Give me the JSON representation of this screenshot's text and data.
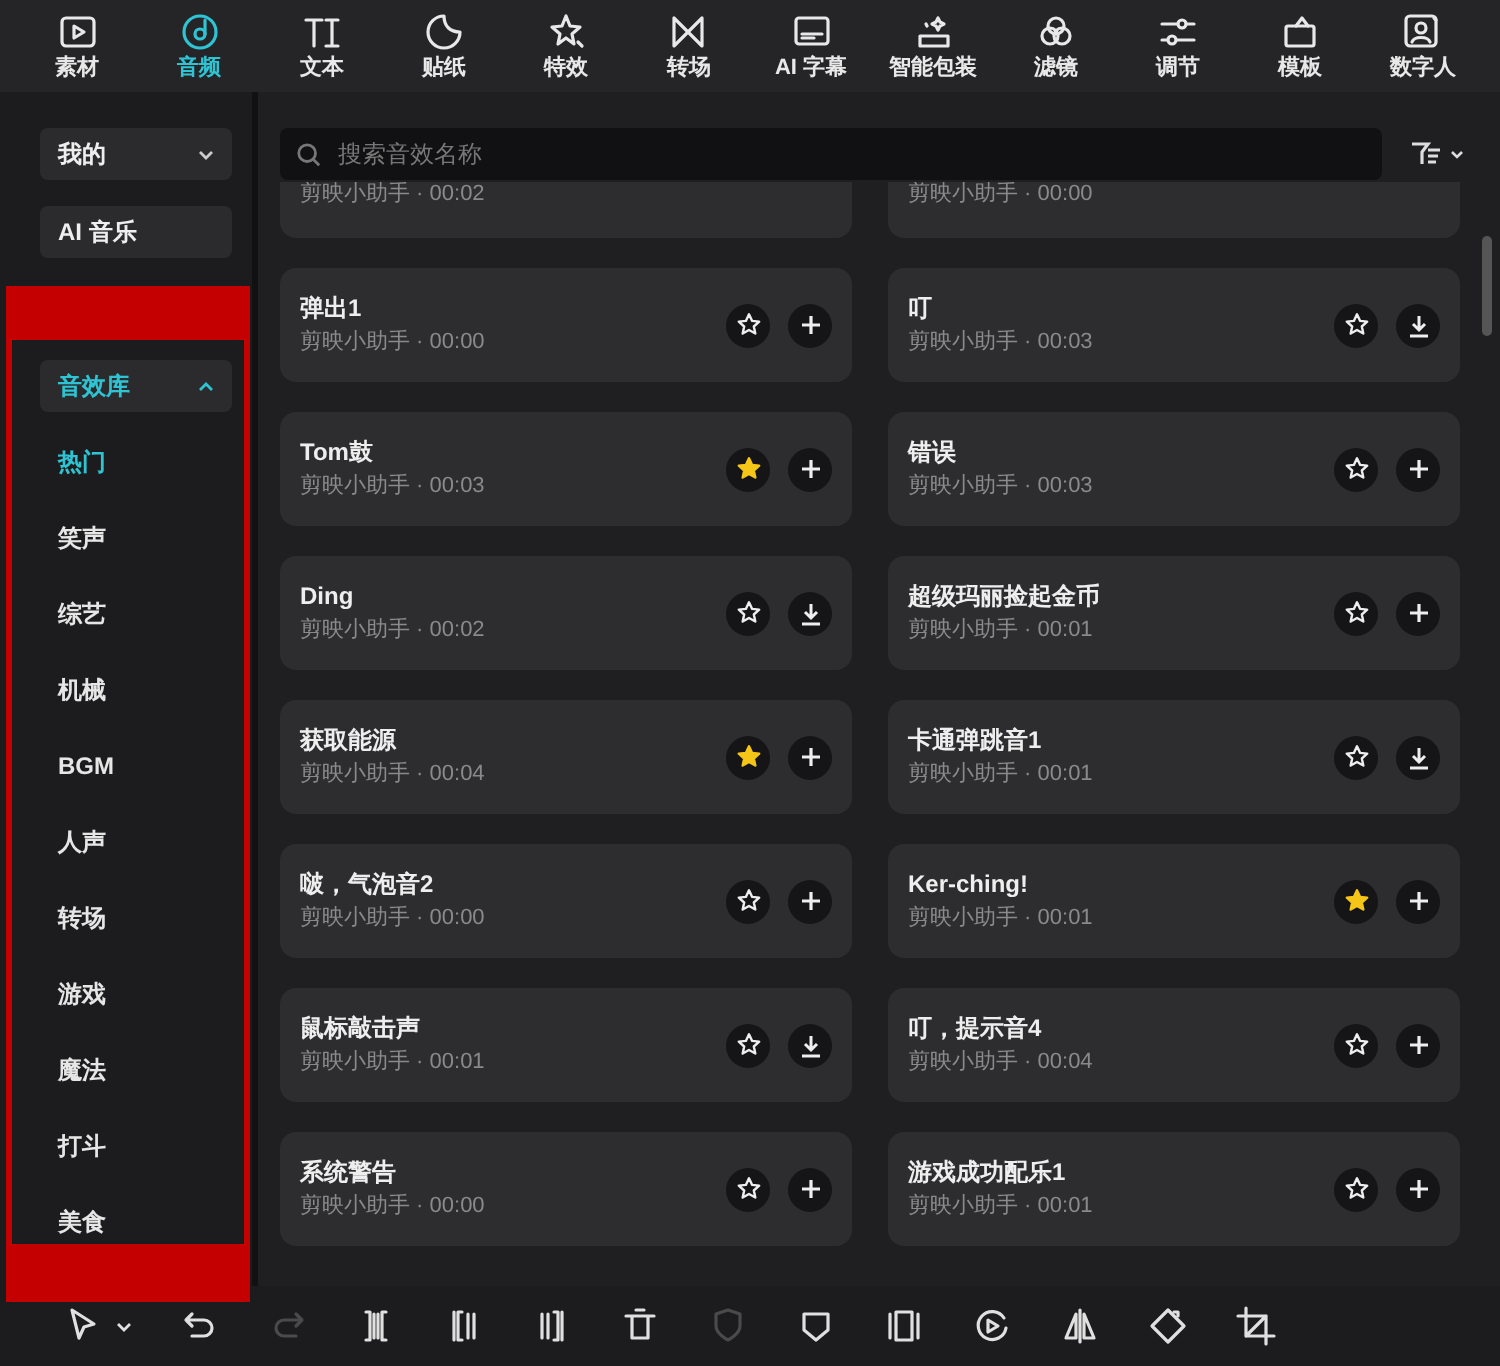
{
  "top_tabs": [
    {
      "kind": "media",
      "label": "素材",
      "selected": false
    },
    {
      "kind": "audio",
      "label": "音频",
      "selected": true
    },
    {
      "kind": "text",
      "label": "文本",
      "selected": false
    },
    {
      "kind": "sticker",
      "label": "贴纸",
      "selected": false
    },
    {
      "kind": "effects",
      "label": "特效",
      "selected": false
    },
    {
      "kind": "transition",
      "label": "转场",
      "selected": false
    },
    {
      "kind": "captions",
      "label": "AI 字幕",
      "selected": false
    },
    {
      "kind": "package",
      "label": "智能包装",
      "selected": false
    },
    {
      "kind": "filter",
      "label": "滤镜",
      "selected": false
    },
    {
      "kind": "adjust",
      "label": "调节",
      "selected": false
    },
    {
      "kind": "template",
      "label": "模板",
      "selected": false
    },
    {
      "kind": "avatar",
      "label": "数字人",
      "selected": false
    }
  ],
  "sidebar": {
    "buttons": [
      {
        "kind": "dropdown",
        "label": "我的",
        "expanded": false
      },
      {
        "kind": "plain",
        "label": "AI 音乐"
      }
    ],
    "library": {
      "label": "音效库",
      "expanded": true
    },
    "categories": [
      {
        "label": "热门",
        "selected": true
      },
      {
        "label": "笑声",
        "selected": false
      },
      {
        "label": "综艺",
        "selected": false
      },
      {
        "label": "机械",
        "selected": false
      },
      {
        "label": "BGM",
        "selected": false
      },
      {
        "label": "人声",
        "selected": false
      },
      {
        "label": "转场",
        "selected": false
      },
      {
        "label": "游戏",
        "selected": false
      },
      {
        "label": "魔法",
        "selected": false
      },
      {
        "label": "打斗",
        "selected": false
      },
      {
        "label": "美食",
        "selected": false
      }
    ]
  },
  "search": {
    "placeholder": "搜索音效名称"
  },
  "sounds": [
    {
      "kind": "partial",
      "subtitle": "剪映小助手 · 00:02"
    },
    {
      "kind": "partial",
      "subtitle": "剪映小助手 · 00:00"
    },
    {
      "kind": "full",
      "title": "弹出1",
      "subtitle": "剪映小助手 · 00:00",
      "favorited": false,
      "needs_download": false
    },
    {
      "kind": "full",
      "title": "叮",
      "subtitle": "剪映小助手 · 00:03",
      "favorited": false,
      "needs_download": true
    },
    {
      "kind": "full",
      "title": "Tom鼓",
      "subtitle": "剪映小助手 · 00:03",
      "favorited": true,
      "needs_download": false
    },
    {
      "kind": "full",
      "title": "错误",
      "subtitle": "剪映小助手 · 00:03",
      "favorited": false,
      "needs_download": false
    },
    {
      "kind": "full",
      "title": "Ding",
      "subtitle": "剪映小助手 · 00:02",
      "favorited": false,
      "needs_download": true
    },
    {
      "kind": "full",
      "title": "超级玛丽捡起金币",
      "subtitle": "剪映小助手 · 00:01",
      "favorited": false,
      "needs_download": false
    },
    {
      "kind": "full",
      "title": "获取能源",
      "subtitle": "剪映小助手 · 00:04",
      "favorited": true,
      "needs_download": false
    },
    {
      "kind": "full",
      "title": "卡通弹跳音1",
      "subtitle": "剪映小助手 · 00:01",
      "favorited": false,
      "needs_download": true
    },
    {
      "kind": "full",
      "title": "啵，气泡音2",
      "subtitle": "剪映小助手 · 00:00",
      "favorited": false,
      "needs_download": false
    },
    {
      "kind": "full",
      "title": "Ker-ching!",
      "subtitle": "剪映小助手 · 00:01",
      "favorited": true,
      "needs_download": false
    },
    {
      "kind": "full",
      "title": "鼠标敲击声",
      "subtitle": "剪映小助手 · 00:01",
      "favorited": false,
      "needs_download": true
    },
    {
      "kind": "full",
      "title": "叮，提示音4",
      "subtitle": "剪映小助手 · 00:04",
      "favorited": false,
      "needs_download": false
    },
    {
      "kind": "full",
      "title": "系统警告",
      "subtitle": "剪映小助手 · 00:00",
      "favorited": false,
      "needs_download": false
    },
    {
      "kind": "full",
      "title": "游戏成功配乐1",
      "subtitle": "剪映小助手 · 00:01",
      "favorited": false,
      "needs_download": false
    }
  ],
  "tools": [
    {
      "kind": "select",
      "disabled": false
    },
    {
      "kind": "undo",
      "disabled": false
    },
    {
      "kind": "redo",
      "disabled": true
    },
    {
      "kind": "split",
      "disabled": false
    },
    {
      "kind": "trim-left",
      "disabled": false
    },
    {
      "kind": "trim-right",
      "disabled": false
    },
    {
      "kind": "delete",
      "disabled": false
    },
    {
      "kind": "shield",
      "disabled": true
    },
    {
      "kind": "marker",
      "disabled": false
    },
    {
      "kind": "freeze",
      "disabled": false
    },
    {
      "kind": "reverse",
      "disabled": false
    },
    {
      "kind": "mirror",
      "disabled": false
    },
    {
      "kind": "rotate",
      "disabled": false
    },
    {
      "kind": "crop",
      "disabled": false
    }
  ]
}
